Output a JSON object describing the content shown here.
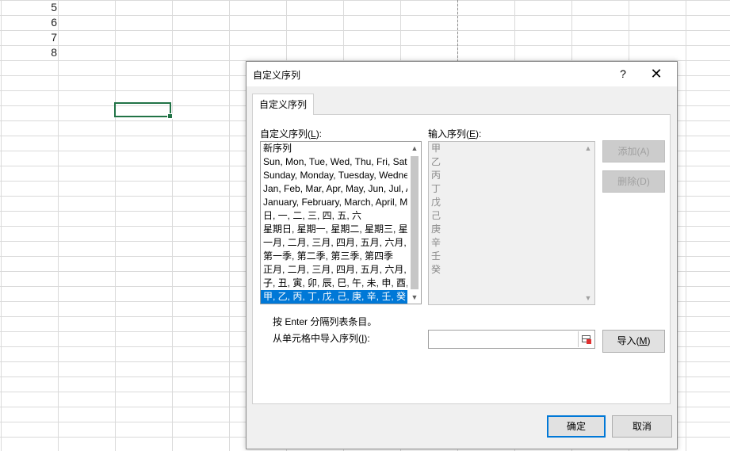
{
  "sheet": {
    "row_numbers": [
      "5",
      "6",
      "7",
      "8"
    ]
  },
  "dialog": {
    "title": "自定义序列",
    "help": "?",
    "close": "✕",
    "tab_label": "自定义序列",
    "custom_lists_label_pre": "自定义序列(",
    "custom_lists_label_key": "L",
    "custom_lists_label_post": "):",
    "custom_lists": [
      "新序列",
      "Sun, Mon, Tue, Wed, Thu, Fri, Sat",
      "Sunday, Monday, Tuesday, Wednesday, Thursday, Friday, Saturday",
      "Jan, Feb, Mar, Apr, May, Jun, Jul, Aug, Sep, Oct, Nov, Dec",
      "January, February, March, April, May, June, July, August, September, October, November, December",
      "日, 一, 二, 三, 四, 五, 六",
      "星期日, 星期一, 星期二, 星期三, 星期四, 星期五, 星期六",
      "一月, 二月, 三月, 四月, 五月, 六月, 七月, 八月, 九月, 十月, 十一月, 十二月",
      "第一季, 第二季, 第三季, 第四季",
      "正月, 二月, 三月, 四月, 五月, 六月, 七月, 八月, 九月, 十月, 十一月, 腊月",
      "子, 丑, 寅, 卯, 辰, 巳, 午, 未, 申, 酉, 戌, 亥",
      "甲, 乙, 丙, 丁, 戊, 己, 庚, 辛, 壬, 癸"
    ],
    "selected_index": 11,
    "entries_label_pre": "输入序列(",
    "entries_label_key": "E",
    "entries_label_post": "):",
    "entries": [
      "甲",
      "乙",
      "丙",
      "丁",
      "戊",
      "己",
      "庚",
      "辛",
      "壬",
      "癸"
    ],
    "add_label_pre": "添加(",
    "add_label_key": "A",
    "add_label_post": ")",
    "delete_label_pre": "删除(",
    "delete_label_key": "D",
    "delete_label_post": ")",
    "hint": "按 Enter 分隔列表条目。",
    "import_label_pre": "从单元格中导入序列(",
    "import_label_key": "I",
    "import_label_post": "):",
    "import_value": "",
    "import_button_pre": "导入(",
    "import_button_key": "M",
    "import_button_post": ")",
    "ok": "确定",
    "cancel": "取消"
  },
  "colors": {
    "selection": "#0078d7",
    "active_cell_border": "#217346"
  },
  "icons": {
    "range_picker": "collapse-dialog-icon",
    "scroll_up": "chevron-up-icon",
    "scroll_down": "chevron-down-icon"
  }
}
